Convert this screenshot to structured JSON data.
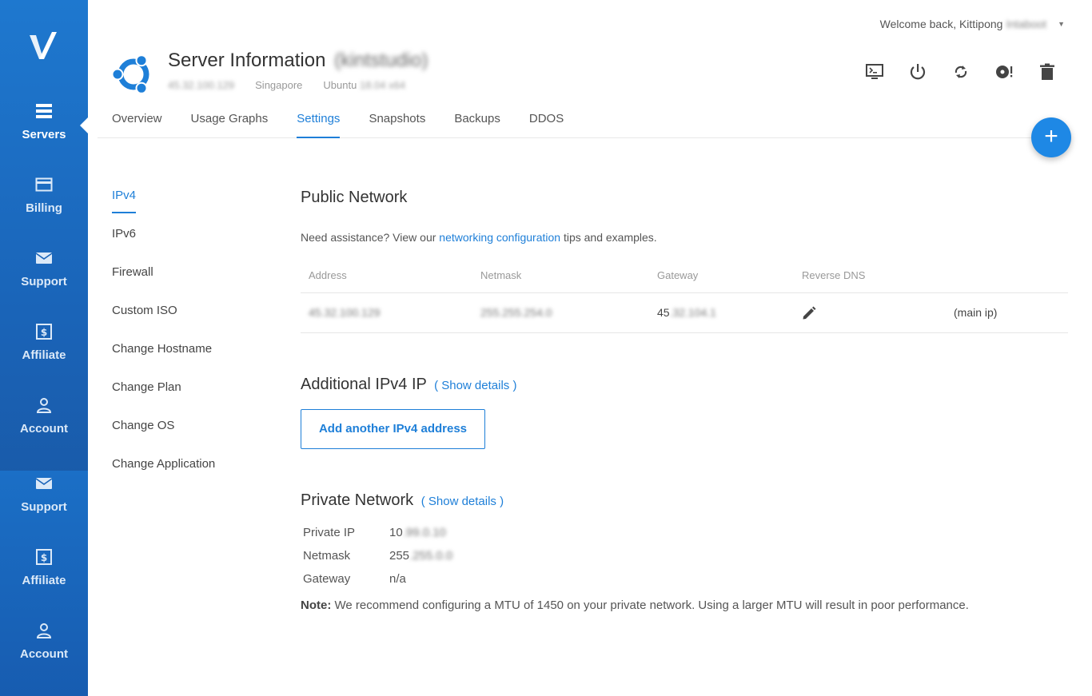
{
  "sidebar": {
    "logo_icon": "vultr-logo",
    "items": [
      {
        "label": "Servers",
        "icon": "servers-icon",
        "active": true
      },
      {
        "label": "Billing",
        "icon": "card-icon"
      },
      {
        "label": "Support",
        "icon": "mail-icon"
      },
      {
        "label": "Affiliate",
        "icon": "dollar-icon"
      },
      {
        "label": "Account",
        "icon": "user-icon"
      },
      {
        "label": "Support",
        "icon": "mail-icon"
      },
      {
        "label": "Affiliate",
        "icon": "dollar-icon"
      },
      {
        "label": "Account",
        "icon": "user-icon"
      }
    ]
  },
  "header": {
    "welcome_prefix": "Welcome back, Kittipong",
    "welcome_name_blurred": "Intaboot",
    "title": "Server Information",
    "title_blurred": "(kintstudio)",
    "meta_ip_blurred": "45.32.100.129",
    "location": "Singapore",
    "os_prefix": "Ubuntu",
    "os_blurred": "18.04 x64",
    "actions": [
      "console-icon",
      "power-icon",
      "restart-icon",
      "reinstall-icon",
      "delete-icon"
    ]
  },
  "tabs": [
    "Overview",
    "Usage Graphs",
    "Settings",
    "Snapshots",
    "Backups",
    "DDOS"
  ],
  "active_tab": "Settings",
  "fab_label": "+",
  "subnav": [
    "IPv4",
    "IPv6",
    "Firewall",
    "Custom ISO",
    "Change Hostname",
    "Change Plan",
    "Change OS",
    "Change Application"
  ],
  "public_network": {
    "heading": "Public Network",
    "assist_prefix": "Need assistance? View our",
    "assist_link": "networking configuration",
    "assist_suffix": "tips and examples.",
    "columns": [
      "Address",
      "Netmask",
      "Gateway",
      "Reverse DNS"
    ],
    "row": {
      "address_blurred": "45.32.100.129",
      "netmask_blurred": "255.255.254.0",
      "gateway_prefix": "45",
      "gateway_blurred": ".32.104.1",
      "edit_icon": "pencil-icon",
      "tag": "(main ip)"
    }
  },
  "additional": {
    "heading": "Additional IPv4 IP",
    "link": "( Show details )",
    "button": "Add another IPv4 address"
  },
  "private_network": {
    "heading": "Private Network",
    "link": "( Show details )",
    "rows": [
      {
        "key": "Private IP",
        "prefix": "10",
        "blurred": ".99.0.10"
      },
      {
        "key": "Netmask",
        "prefix": "255",
        "blurred": ".255.0.0"
      },
      {
        "key": "Gateway",
        "prefix": "n/a",
        "blurred": ""
      }
    ],
    "note_label": "Note:",
    "note_text": "We recommend configuring a MTU of 1450 on your private network. Using a larger MTU will result in poor performance."
  },
  "colors": {
    "accent": "#1e7fd8",
    "sidebar": "#1a64b8",
    "fab": "#1e88e5"
  }
}
